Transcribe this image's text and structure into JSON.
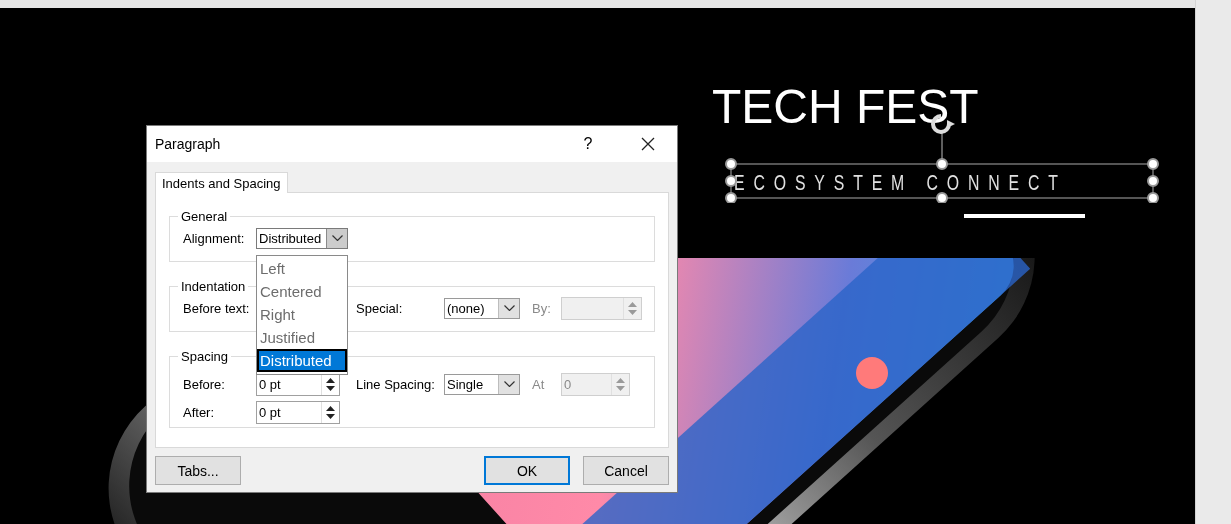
{
  "slide": {
    "title": "TECH FEST",
    "subtitle": "ECOSYSTEM CONNECT",
    "subtitle_selected": true
  },
  "dialog": {
    "title": "Paragraph",
    "help": "?",
    "tabs": [
      {
        "label": "Indents and Spacing",
        "selected": true
      }
    ],
    "general": {
      "title": "General",
      "alignment": {
        "label": "Alignment:",
        "value": "Distributed",
        "expanded": true,
        "options": [
          {
            "label": "Left",
            "selected": false
          },
          {
            "label": "Centered",
            "selected": false
          },
          {
            "label": "Right",
            "selected": false
          },
          {
            "label": "Justified",
            "selected": false
          },
          {
            "label": "Distributed",
            "selected": true
          }
        ]
      }
    },
    "indentation": {
      "title": "Indentation",
      "before_text": {
        "label": "Before text:"
      },
      "special": {
        "label": "Special:",
        "value": "(none)"
      },
      "by": {
        "label": "By:",
        "disabled": true
      }
    },
    "spacing": {
      "title": "Spacing",
      "before": {
        "label": "Before:",
        "value": "0 pt"
      },
      "after": {
        "label": "After:",
        "value": "0 pt"
      },
      "line_spacing": {
        "label": "Line Spacing:",
        "value": "Single"
      },
      "at": {
        "label": "At",
        "value": "0",
        "disabled": true
      }
    },
    "buttons": [
      {
        "label": "Tabs...",
        "default": false
      },
      {
        "label": "OK",
        "default": true
      },
      {
        "label": "Cancel",
        "default": false
      }
    ]
  }
}
